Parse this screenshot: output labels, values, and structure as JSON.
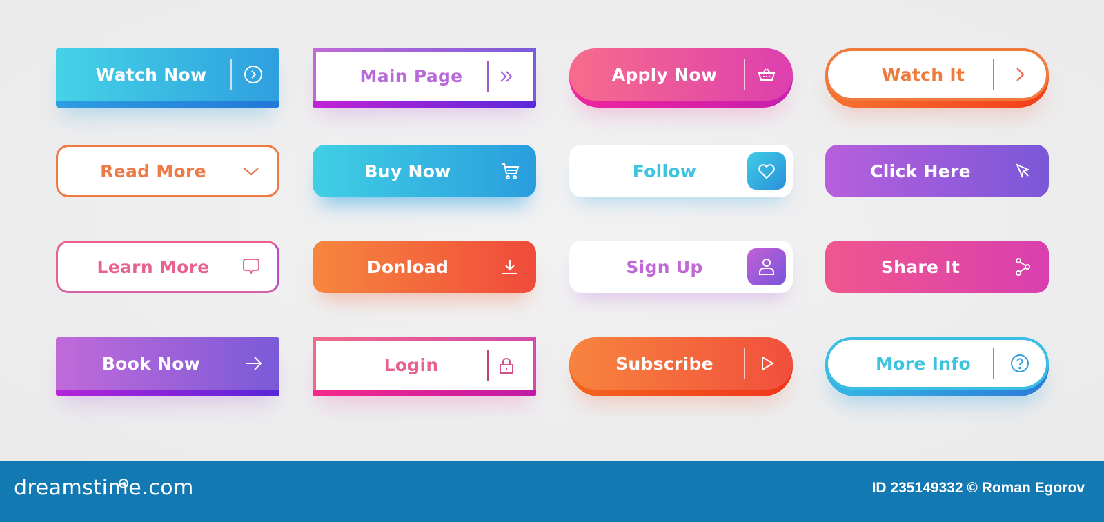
{
  "buttons": {
    "watch_now": {
      "label": "Watch Now",
      "icon": "chevron-right-circle-icon",
      "color": "#2e9fdf"
    },
    "main_page": {
      "label": "Main Page",
      "icon": "double-chevron-right-icon",
      "color": "#b86ad8"
    },
    "apply_now": {
      "label": "Apply Now",
      "icon": "basket-icon",
      "color": "#e84aa6"
    },
    "watch_it": {
      "label": "Watch It",
      "icon": "chevron-right-icon",
      "color": "#f07a3c"
    },
    "read_more": {
      "label": "Read More",
      "icon": "chevron-down-icon",
      "color": "#ee7a46"
    },
    "buy_now": {
      "label": "Buy Now",
      "icon": "cart-icon",
      "color": "#2e9fdf"
    },
    "follow": {
      "label": "Follow",
      "icon": "heart-icon",
      "color": "#3cc4dd"
    },
    "click_here": {
      "label": "Click Here",
      "icon": "cursor-icon",
      "color": "#9a5cd9"
    },
    "learn_more": {
      "label": "Learn More",
      "icon": "chat-bubble-icon",
      "color": "#e8628e"
    },
    "donload": {
      "label": "Donload",
      "icon": "download-icon",
      "color": "#f36a3d"
    },
    "sign_up": {
      "label": "Sign Up",
      "icon": "user-icon",
      "color": "#c068d6"
    },
    "share_it": {
      "label": "Share It",
      "icon": "share-icon",
      "color": "#e84b9e"
    },
    "book_now": {
      "label": "Book Now",
      "icon": "arrow-right-icon",
      "color": "#9a5cd9"
    },
    "login": {
      "label": "Login",
      "icon": "lock-icon",
      "color": "#e8628e"
    },
    "subscribe": {
      "label": "Subscribe",
      "icon": "play-icon",
      "color": "#f36a3d"
    },
    "more_info": {
      "label": "More Info",
      "icon": "question-circle-icon",
      "color": "#3cc4dd"
    }
  },
  "footer": {
    "logo": "dreamstime.com",
    "credit": "ID 235149332 © Roman Egorov",
    "background": "#1379b3"
  }
}
